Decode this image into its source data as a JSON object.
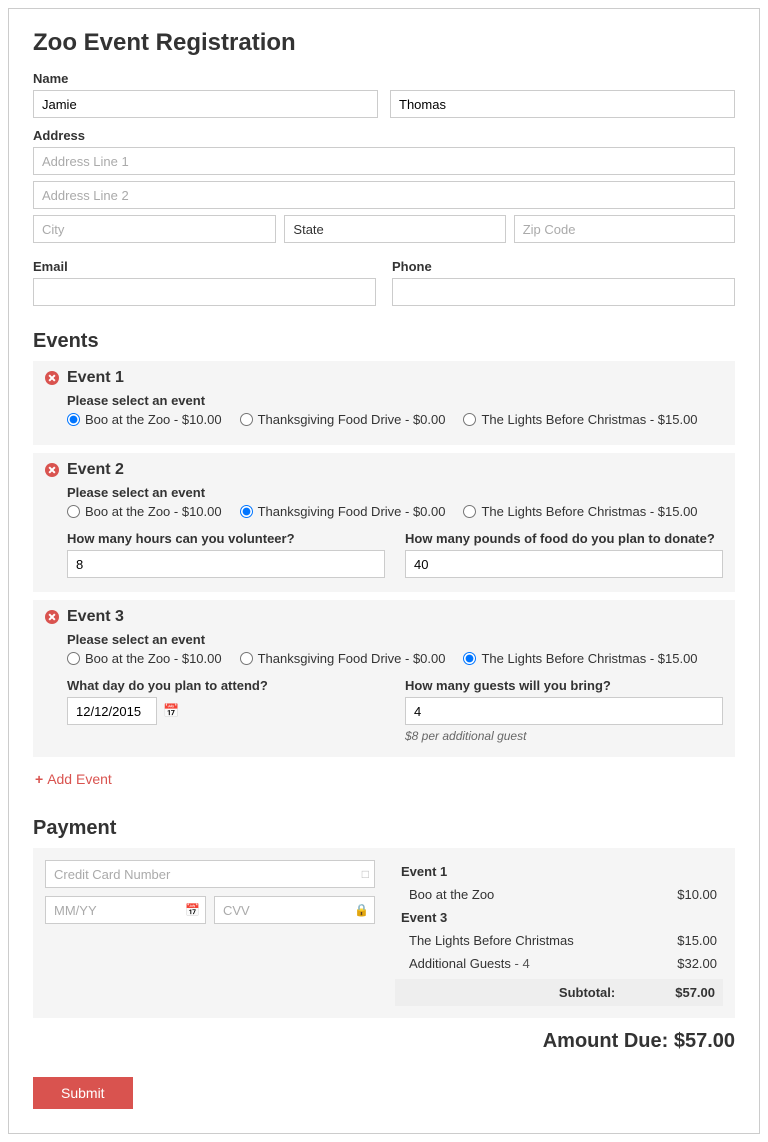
{
  "title": "Zoo Event Registration",
  "name": {
    "label": "Name",
    "first": "Jamie",
    "last": "Thomas"
  },
  "address": {
    "label": "Address",
    "line1_placeholder": "Address Line 1",
    "line2_placeholder": "Address Line 2",
    "city_placeholder": "City",
    "state_value": "State",
    "zip_placeholder": "Zip Code"
  },
  "email": {
    "label": "Email"
  },
  "phone": {
    "label": "Phone"
  },
  "events_heading": "Events",
  "select_label": "Please select an event",
  "options": {
    "boo": "Boo at the Zoo - $10.00",
    "food": "Thanksgiving Food Drive - $0.00",
    "lights": "The Lights Before Christmas - $15.00"
  },
  "event1": {
    "title": "Event 1"
  },
  "event2": {
    "title": "Event 2",
    "hours_label": "How many hours can you volunteer?",
    "hours_value": "8",
    "pounds_label": "How many pounds of food do you plan to donate?",
    "pounds_value": "40"
  },
  "event3": {
    "title": "Event 3",
    "date_label": "What day do you plan to attend?",
    "date_value": "12/12/2015",
    "guests_label": "How many guests will you bring?",
    "guests_value": "4",
    "guests_hint": "$8 per additional guest"
  },
  "add_event_label": "Add Event",
  "payment_heading": "Payment",
  "payment": {
    "cc_placeholder": "Credit Card Number",
    "exp_placeholder": "MM/YY",
    "cvv_placeholder": "CVV"
  },
  "summary": {
    "e1_head": "Event 1",
    "e1_item": "Boo at the Zoo",
    "e1_price": "$10.00",
    "e3_head": "Event 3",
    "e3_item": "The Lights Before Christmas",
    "e3_price": "$15.00",
    "e3_guests_label": "Additional Guests",
    "e3_guests_count": " - 4",
    "e3_guests_price": "$32.00",
    "subtotal_label": "Subtotal:",
    "subtotal_value": "$57.00"
  },
  "amount_due_label": "Amount Due: ",
  "amount_due_value": "$57.00",
  "submit_label": "Submit"
}
